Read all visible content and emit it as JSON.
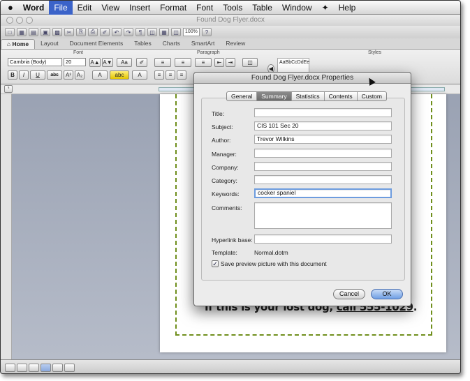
{
  "menubar": {
    "apple": "",
    "items": [
      "Word",
      "File",
      "Edit",
      "View",
      "Insert",
      "Format",
      "Font",
      "Tools",
      "Table",
      "Window",
      "Help"
    ],
    "script_icon": "script-menu-icon"
  },
  "window": {
    "title": "Found Dog Flyer.docx"
  },
  "toolbar": {
    "zoom": "100%"
  },
  "ribbon_tabs": [
    "Home",
    "Layout",
    "Document Elements",
    "Tables",
    "Charts",
    "SmartArt",
    "Review"
  ],
  "ribbon": {
    "groups": {
      "font": "Font",
      "paragraph": "Paragraph",
      "styles": "Styles"
    },
    "font_name": "Cambria (Body)",
    "font_size": "20",
    "style_preview": "AaBbCcDdEe"
  },
  "document": {
    "visible_text_prefix": "If this is your lost dog, ",
    "visible_text_link": "call 555-1029",
    "visible_text_suffix": "."
  },
  "dialog": {
    "title": "Found Dog Flyer.docx Properties",
    "tabs": [
      "General",
      "Summary",
      "Statistics",
      "Contents",
      "Custom"
    ],
    "selected_tab": "Summary",
    "fields": {
      "title": {
        "label": "Title:",
        "value": ""
      },
      "subject": {
        "label": "Subject:",
        "value": "CIS 101 Sec 20"
      },
      "author": {
        "label": "Author:",
        "value": "Trevor Wilkins"
      },
      "manager": {
        "label": "Manager:",
        "value": ""
      },
      "company": {
        "label": "Company:",
        "value": ""
      },
      "category": {
        "label": "Category:",
        "value": ""
      },
      "keywords": {
        "label": "Keywords:",
        "value": "cocker spaniel"
      },
      "comments": {
        "label": "Comments:",
        "value": ""
      },
      "hyperlink": {
        "label": "Hyperlink base:",
        "value": ""
      }
    },
    "template_label": "Template:",
    "template_value": "Normal.dotm",
    "save_preview_label": "Save preview picture with this document",
    "save_preview_checked": true,
    "cancel_label": "Cancel",
    "ok_label": "OK"
  },
  "colors": {
    "menu_highlight": "#3b63c9",
    "page_border": "#6f8f1c",
    "default_button": "#6f9fe4"
  }
}
